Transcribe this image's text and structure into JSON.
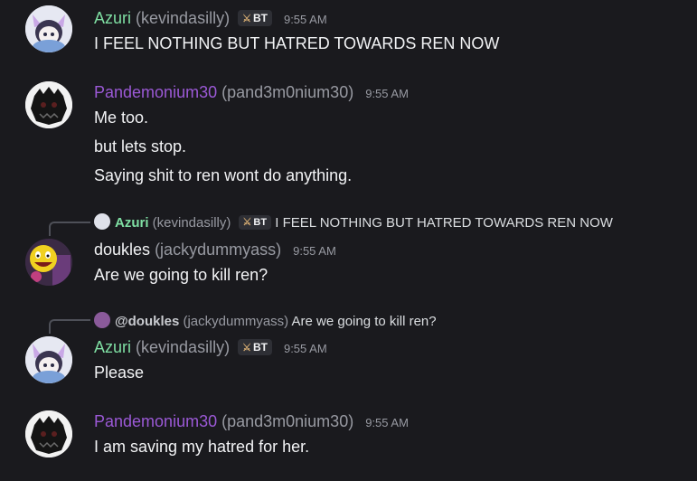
{
  "messages": [
    {
      "author": "Azuri",
      "handle": "(kevindasilly)",
      "tag": "BT",
      "time": "9:55 AM",
      "lines": [
        "I FEEL NOTHING BUT HATRED TOWARDS REN NOW"
      ]
    },
    {
      "author": "Pandemonium30",
      "handle": "(pand3m0nium30)",
      "time": "9:55 AM",
      "lines": [
        "Me too.",
        "but lets stop.",
        "Saying shit to ren wont do anything."
      ]
    },
    {
      "reply": {
        "author": "Azuri",
        "handle": "(kevindasilly)",
        "tag": "BT",
        "text": "I FEEL NOTHING BUT HATRED TOWARDS REN NOW"
      },
      "author": "doukles",
      "handle": "(jackydummyass)",
      "time": "9:55 AM",
      "lines": [
        "Are we going to kill  ren?"
      ]
    },
    {
      "reply": {
        "author": "@doukles",
        "handle": "(jackydummyass)",
        "text": "Are we going to kill  ren?"
      },
      "author": "Azuri",
      "handle": "(kevindasilly)",
      "tag": "BT",
      "time": "9:55 AM",
      "lines": [
        "Please"
      ]
    },
    {
      "author": "Pandemonium30",
      "handle": "(pand3m0nium30)",
      "time": "9:55 AM",
      "lines": [
        "I am saving my hatred for her."
      ]
    }
  ]
}
